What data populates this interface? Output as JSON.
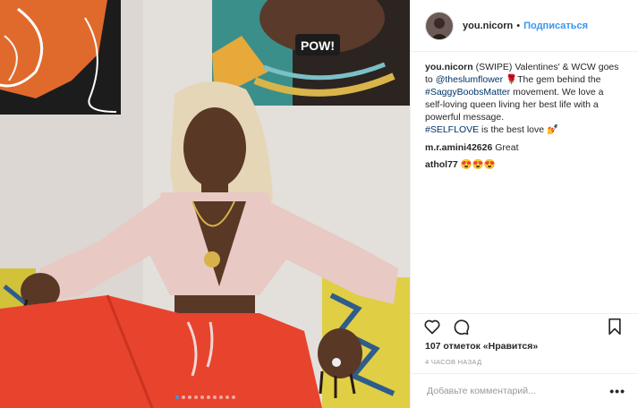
{
  "post": {
    "dots_count": 10,
    "active_dot": 0
  },
  "header": {
    "username": "you.nicorn",
    "separator": "•",
    "follow_label": "Подписаться"
  },
  "caption": {
    "username": "you.nicorn",
    "text_1": " (SWIPE) Valentines' & WCW goes to ",
    "mention": "@theslumflower",
    "text_2": " 🌹The gem behind the ",
    "hashtag_1": "#SaggyBoobsMatter",
    "text_3": " movement. We love a self-loving queen living her best life with a powerful message.",
    "hashtag_2": "#SELFLOVE",
    "text_4": " is the best love 💅"
  },
  "comments": [
    {
      "username": "m.r.amini42626",
      "text": " Great"
    },
    {
      "username": "athol77",
      "text": " 😍😍😍"
    }
  ],
  "actions": {
    "like_icon": "heart-icon",
    "comment_icon": "comment-icon",
    "save_icon": "bookmark-icon"
  },
  "likes_text": "107 отметок «Нравится»",
  "timestamp": "4 ЧАСОВ НАЗАД",
  "add_comment": {
    "placeholder": "Добавьте комментарий...",
    "more_label": "•••"
  },
  "colors": {
    "accent": "#3897f0",
    "link": "#003569",
    "pants": "#e8432d",
    "top": "#e9c9c4",
    "wall": "#d9d4cf"
  }
}
